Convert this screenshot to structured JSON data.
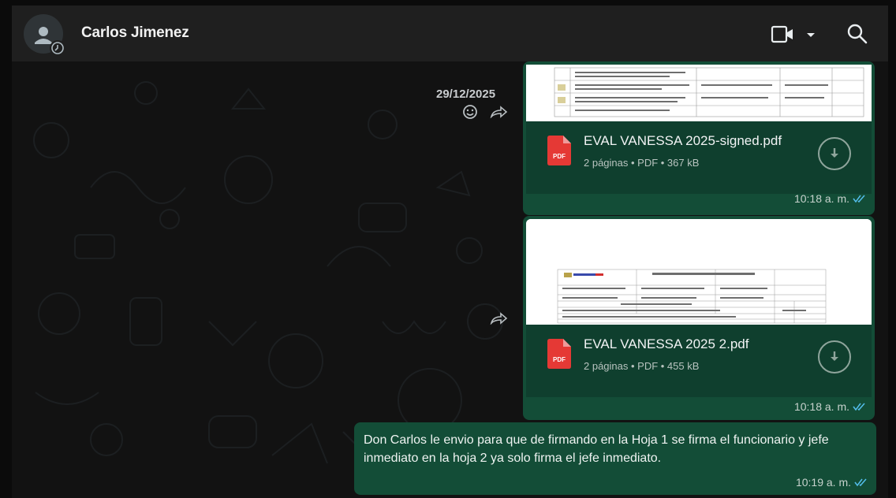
{
  "header": {
    "contact_name": "Carlos Jimenez",
    "avatar_icon": "default-user-avatar-icon",
    "video_icon": "video-call-icon",
    "dropdown_icon": "chevron-down-icon",
    "search_icon": "search-icon"
  },
  "chat": {
    "date_label": "29/12/2025",
    "messages": [
      {
        "type": "document",
        "file_name": "EVAL VANESSA 2025-signed.pdf",
        "meta": "2 páginas • PDF • 367 kB",
        "time": "10:18 a. m.",
        "status": "read"
      },
      {
        "type": "document",
        "file_name": "EVAL VANESSA 2025 2.pdf",
        "meta": "2 páginas • PDF • 455 kB",
        "time": "10:18 a. m.",
        "status": "read"
      },
      {
        "type": "text",
        "text": "Don Carlos le envio para que de firmando en la Hoja 1 se firma el funcionario y jefe inmediato en la hoja 2 ya solo firma el jefe inmediato.",
        "time": "10:19 a. m.",
        "status": "read"
      }
    ]
  },
  "colors": {
    "header_bg": "#1f1f1f",
    "chat_bg": "#121212",
    "outgoing_bubble": "#134d37",
    "read_ticks": "#53bdeb",
    "pdf_red": "#e53935"
  }
}
